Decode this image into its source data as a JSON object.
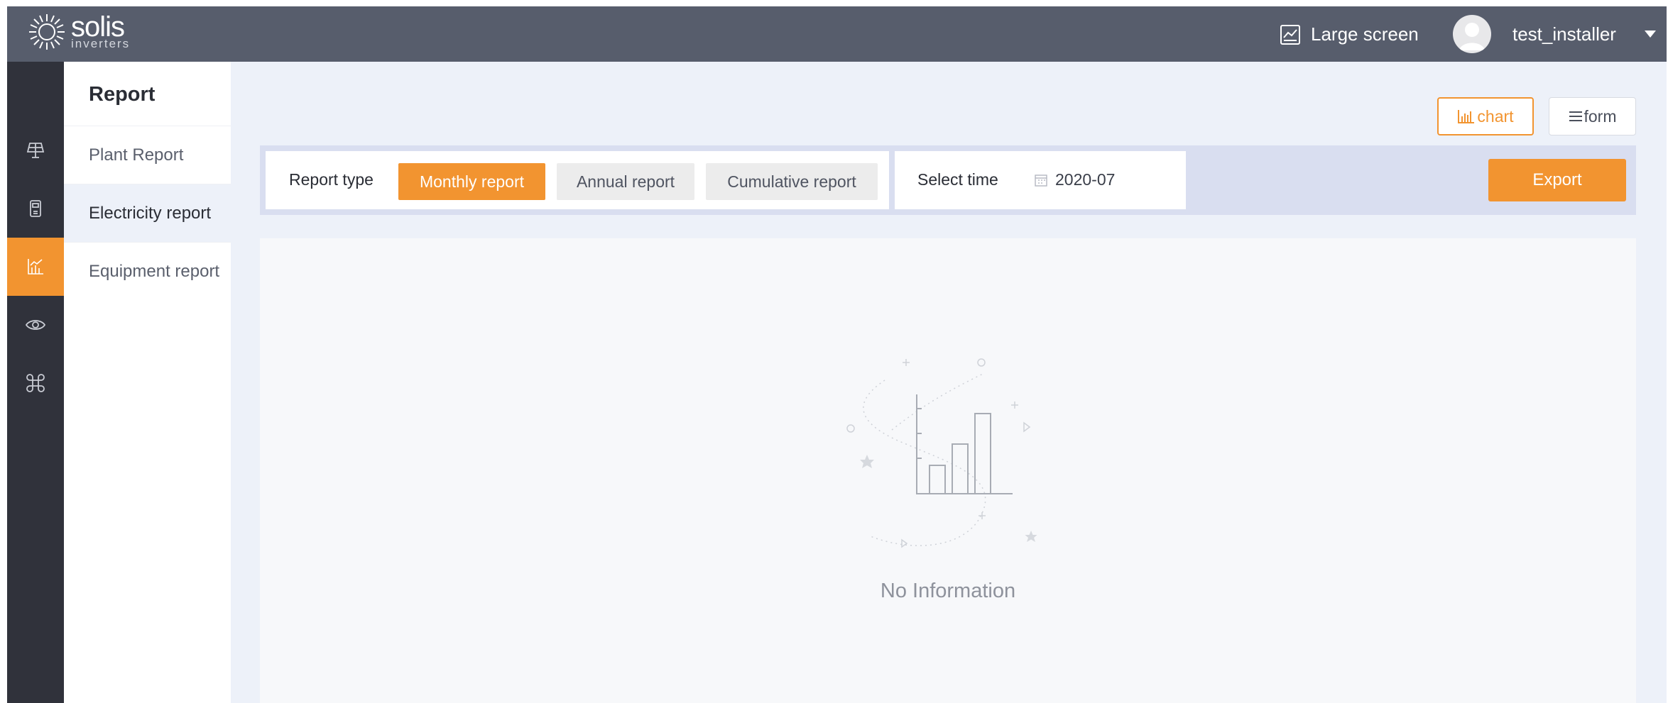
{
  "brand": {
    "name": "solis",
    "sub": "inverters"
  },
  "header": {
    "large_screen": "Large screen",
    "username": "test_installer"
  },
  "rail": {
    "items": [
      {
        "icon": "solar-panel-icon",
        "active": false
      },
      {
        "icon": "inverter-device-icon",
        "active": false
      },
      {
        "icon": "report-chart-icon",
        "active": true
      },
      {
        "icon": "eye-icon",
        "active": false
      },
      {
        "icon": "command-icon",
        "active": false
      }
    ]
  },
  "submenu": {
    "title": "Report",
    "items": [
      {
        "label": "Plant Report",
        "active": false
      },
      {
        "label": "Electricity report",
        "active": true
      },
      {
        "label": "Equipment report",
        "active": false
      }
    ]
  },
  "view_toggle": {
    "chart": "chart",
    "form": "form",
    "selected": "chart"
  },
  "filters": {
    "report_type_label": "Report type",
    "types": [
      {
        "label": "Monthly report",
        "selected": true
      },
      {
        "label": "Annual report",
        "selected": false
      },
      {
        "label": "Cumulative report",
        "selected": false
      }
    ],
    "select_time_label": "Select time",
    "time_value": "2020-07"
  },
  "export_label": "Export",
  "empty_state": {
    "text": "No Information"
  },
  "colors": {
    "accent": "#f29430",
    "topbar": "#575d6c",
    "rail": "#30323b",
    "page": "#edf1f9"
  }
}
